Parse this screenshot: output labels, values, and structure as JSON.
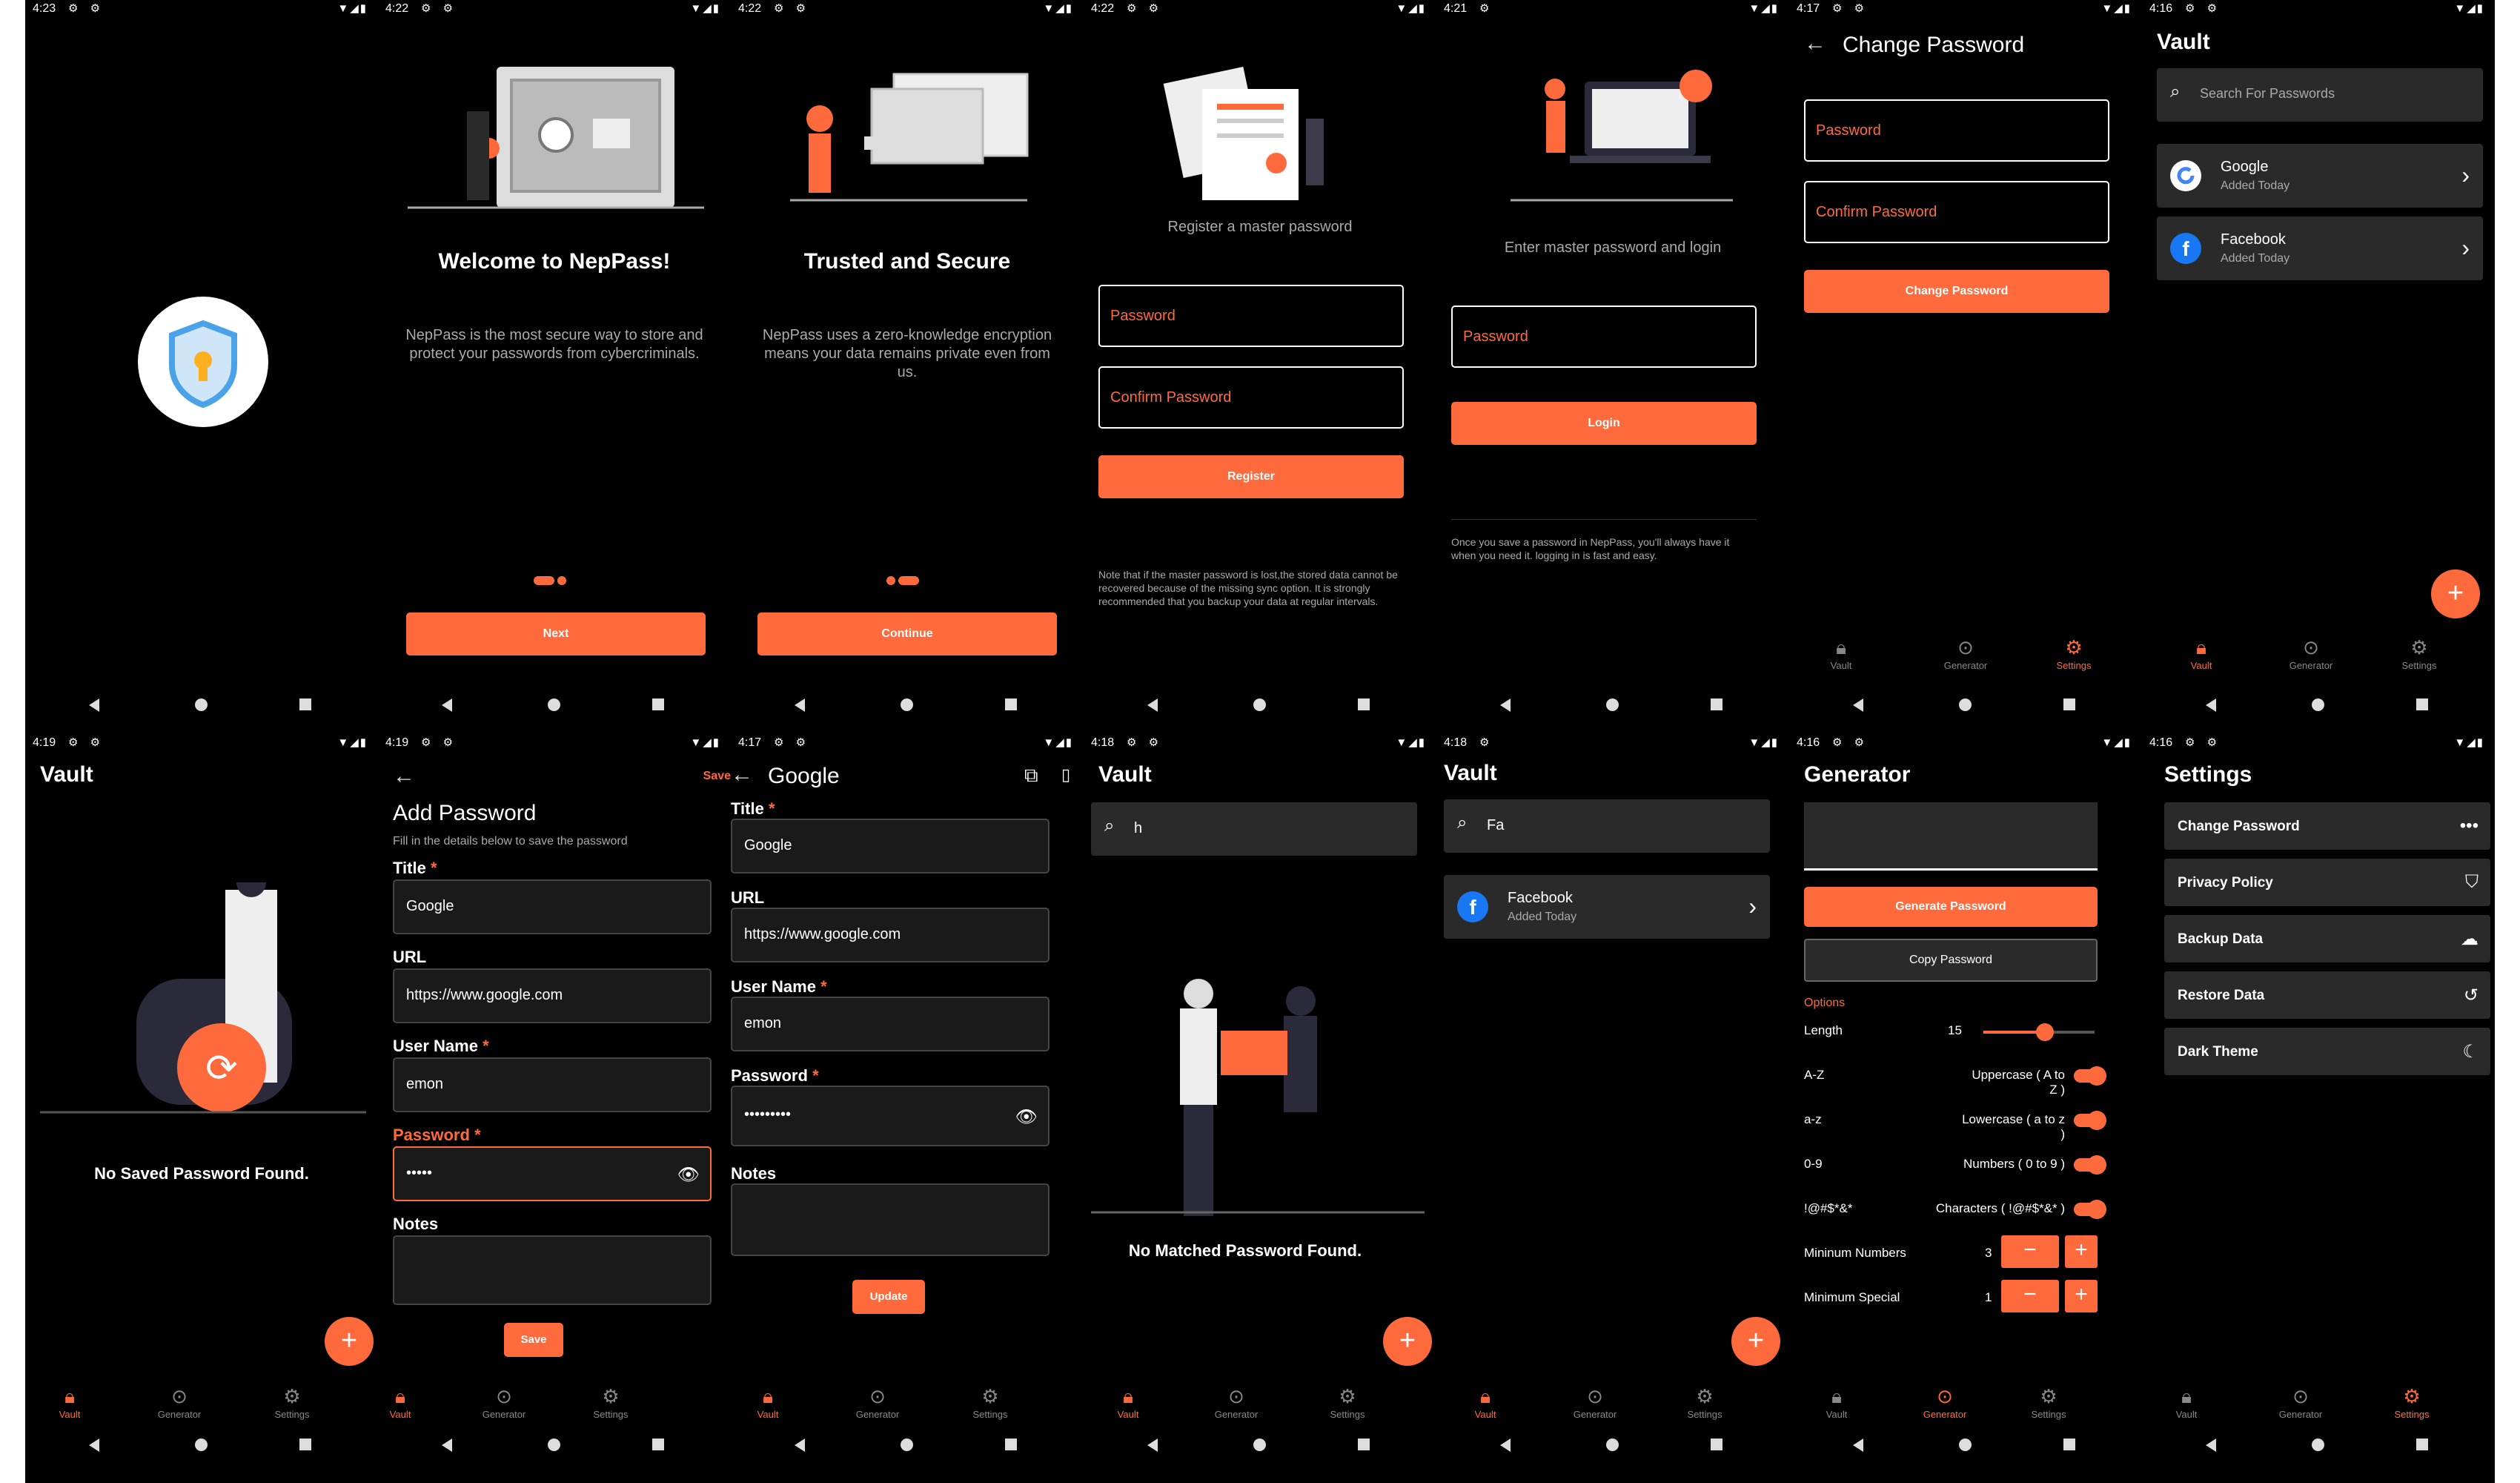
{
  "accent": "#ff6a3d",
  "nav": {
    "vault": "Vault",
    "generator": "Generator",
    "settings": "Settings"
  },
  "s1": {
    "time": "4:23"
  },
  "s2": {
    "time": "4:22",
    "title": "Welcome to NepPass!",
    "body": "NepPass is the most secure way to store and protect your passwords from cybercriminals.",
    "button": "Next"
  },
  "s3": {
    "time": "4:22",
    "title": "Trusted and Secure",
    "body": "NepPass uses a zero-knowledge encryption means your data remains private even from us.",
    "button": "Continue"
  },
  "s4": {
    "time": "4:22",
    "subtitle": "Register a master password",
    "password": "Password",
    "confirm": "Confirm Password",
    "button": "Register",
    "note": "Note that if the master password is lost,the stored data cannot be recovered because of the missing sync option. It is strongly recommended that you backup your  data at regular intervals."
  },
  "s5": {
    "time": "4:21",
    "subtitle": "Enter master password and login",
    "password": "Password",
    "button": "Login",
    "note": "Once you save a password in NepPass, you'll always have it when you need it. logging in is fast and easy."
  },
  "s6": {
    "time": "4:17",
    "title": "Change Password",
    "password": "Password",
    "confirm": "Confirm Password",
    "button": "Change Password"
  },
  "s7": {
    "time": "4:16",
    "title": "Vault",
    "search_placeholder": "Search For Passwords",
    "items": [
      {
        "name": "Google",
        "date": "Added Today"
      },
      {
        "name": "Facebook",
        "date": "Added Today"
      }
    ]
  },
  "s8": {
    "time": "4:19",
    "title": "Vault",
    "empty": "No Saved Password Found."
  },
  "s9": {
    "time": "4:19",
    "action": "Save",
    "title": "Add Password",
    "subtitle": "Fill in the details below to save the password",
    "title_label": "Title",
    "title_value": "Google",
    "url_label": "URL",
    "url_value": "https://www.google.com",
    "user_label": "User Name",
    "user_value": "emon",
    "pass_label": "Password",
    "pass_value": "•••••",
    "notes_label": "Notes",
    "button": "Save"
  },
  "s10": {
    "time": "4:17",
    "title": "Google",
    "title_label": "Title",
    "title_value": "Google",
    "url_label": "URL",
    "url_value": "https://www.google.com",
    "user_label": "User Name",
    "user_value": "emon",
    "pass_label": "Password",
    "pass_value": "•••••••••",
    "notes_label": "Notes",
    "button": "Update"
  },
  "s11": {
    "time": "4:18",
    "title": "Vault",
    "query": "h",
    "empty": "No Matched Password Found."
  },
  "s12": {
    "time": "4:18",
    "title": "Vault",
    "query": "Fa",
    "items": [
      {
        "name": "Facebook",
        "date": "Added Today"
      }
    ]
  },
  "s13": {
    "time": "4:16",
    "title": "Generator",
    "generate": "Generate Password",
    "copy": "Copy Password",
    "options": "Options",
    "length_label": "Length",
    "length_value": "15",
    "length_fraction": 0.55,
    "rows": [
      {
        "key": "A-Z",
        "desc": "Uppercase ( A to Z )"
      },
      {
        "key": "a-z",
        "desc": "Lowercase ( a to z )"
      },
      {
        "key": "0-9",
        "desc": "Numbers ( 0 to 9 )"
      },
      {
        "key": "!@#$*&*",
        "desc": "Characters ( !@#$*&* )"
      }
    ],
    "min_numbers_label": "Mininum Numbers",
    "min_numbers": "3",
    "min_special_label": "Minimum Special",
    "min_special": "1",
    "minus": "−",
    "plus": "+"
  },
  "s14": {
    "time": "4:16",
    "title": "Settings",
    "items": [
      {
        "label": "Change Password",
        "icon": "•••"
      },
      {
        "label": "Privacy Policy",
        "icon": "⛉"
      },
      {
        "label": "Backup Data",
        "icon": "☁"
      },
      {
        "label": "Restore Data",
        "icon": "↺"
      },
      {
        "label": "Dark Theme",
        "icon": "☾"
      }
    ]
  }
}
